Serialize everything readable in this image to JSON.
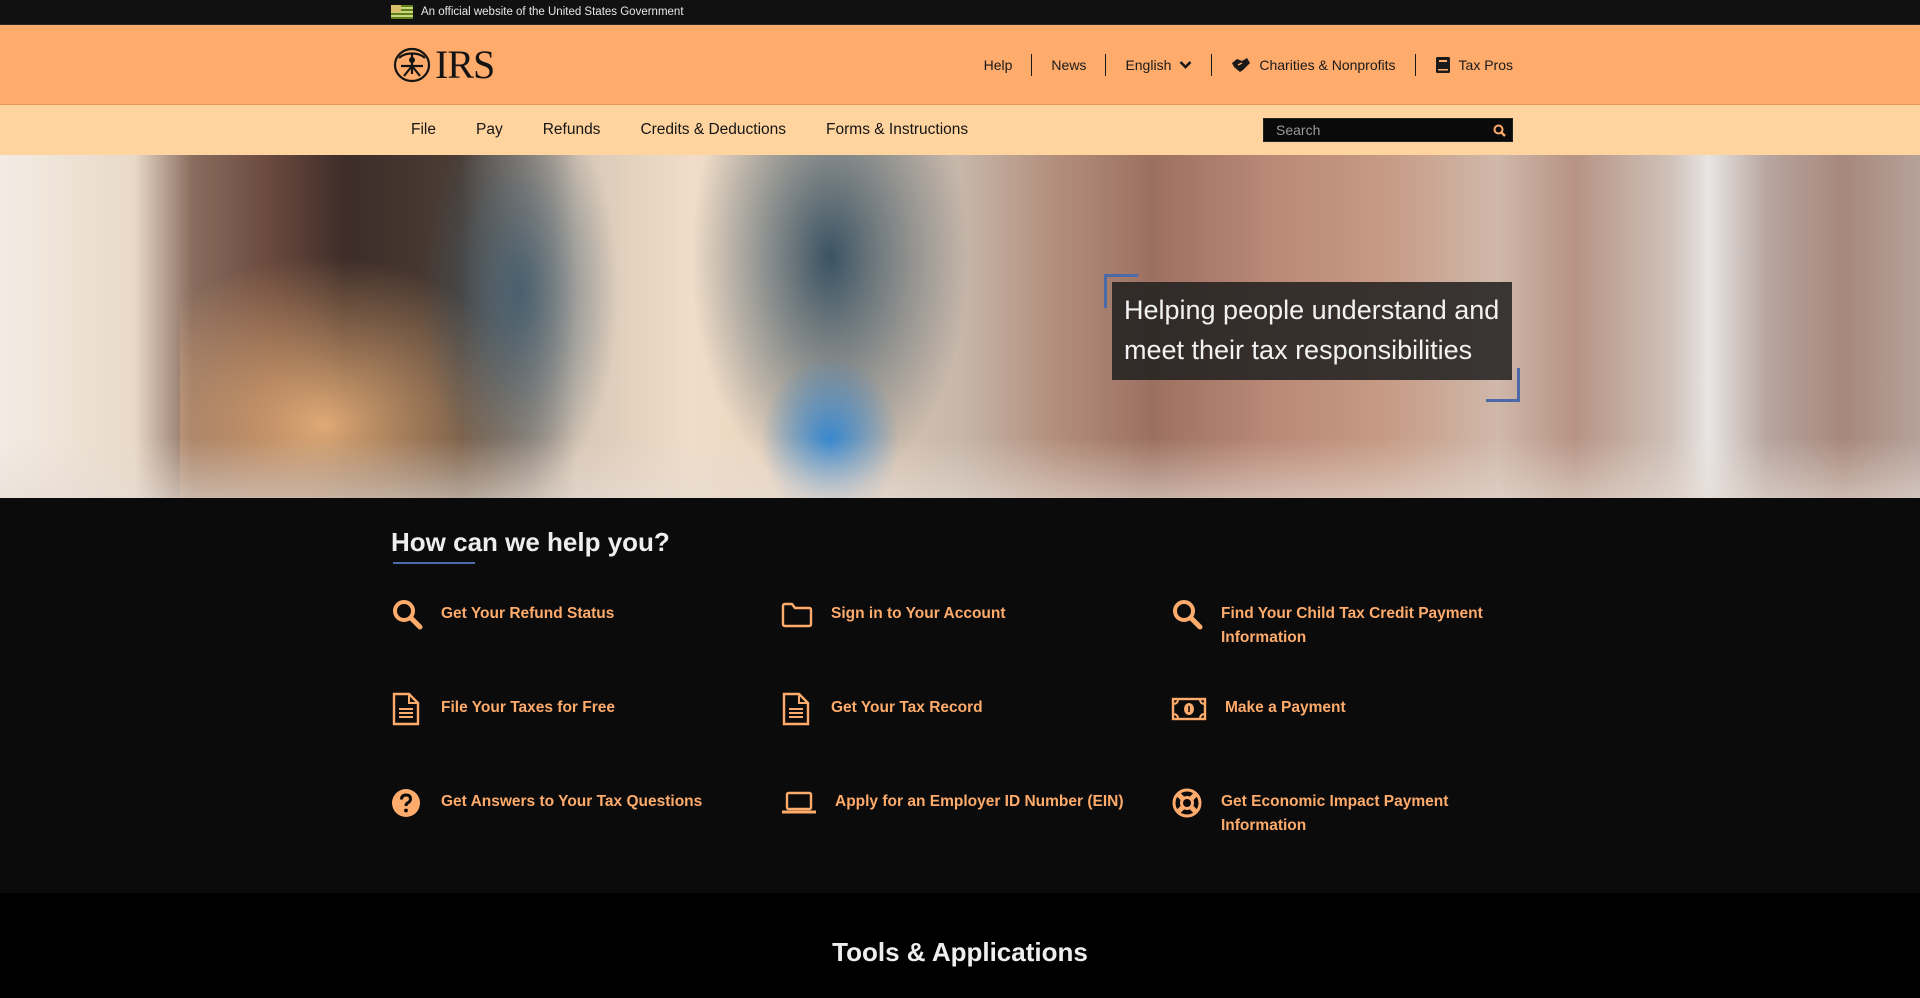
{
  "gov_banner": {
    "text": "An official website of the United States Government"
  },
  "header": {
    "logo_text": "IRS",
    "utility": {
      "help": "Help",
      "news": "News",
      "language": "English",
      "charities": "Charities & Nonprofits",
      "tax_pros": "Tax Pros"
    }
  },
  "nav": {
    "items": [
      "File",
      "Pay",
      "Refunds",
      "Credits & Deductions",
      "Forms & Instructions"
    ],
    "search_placeholder": "Search"
  },
  "hero": {
    "caption": "Helping people understand and meet their tax responsibilities"
  },
  "help": {
    "title": "How can we help you?",
    "items": [
      {
        "label": "Get Your Refund Status",
        "icon": "search-icon"
      },
      {
        "label": "Sign in to Your Account",
        "icon": "folder-icon"
      },
      {
        "label": "Find Your Child Tax Credit Payment Information",
        "icon": "search-icon"
      },
      {
        "label": "File Your Taxes for Free",
        "icon": "document-icon"
      },
      {
        "label": "Get Your Tax Record",
        "icon": "document-icon"
      },
      {
        "label": "Make a Payment",
        "icon": "money-icon"
      },
      {
        "label": "Get Answers to Your Tax Questions",
        "icon": "question-icon"
      },
      {
        "label": "Apply for an Employer ID Number (EIN)",
        "icon": "laptop-icon"
      },
      {
        "label": "Get Economic Impact Payment Information",
        "icon": "lifebuoy-icon"
      }
    ]
  },
  "tools": {
    "title": "Tools & Applications"
  },
  "colors": {
    "accent": "#ffab6b",
    "header_bg": "#ffab6b",
    "nav_bg": "#ffd49e",
    "underline": "#4a6aa8"
  }
}
